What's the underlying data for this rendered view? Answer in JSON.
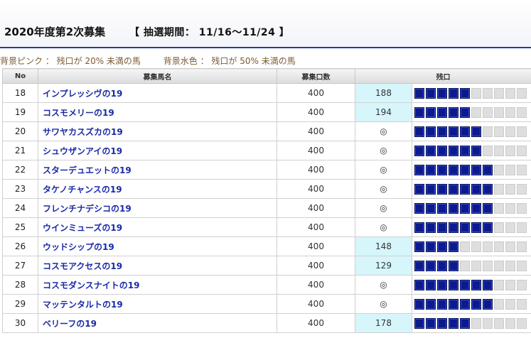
{
  "header": {
    "title": "2020年度第2次募集",
    "period": "【 抽選期間： 11/16～11/24 】"
  },
  "notes": {
    "pink": "背景ピンク ： 残口が 20% 未満の馬",
    "blue": "背景水色 ： 残口が 50% 未満の馬"
  },
  "table": {
    "columns": [
      "No",
      "募集馬名",
      "募集口数",
      "残口"
    ],
    "gauge_segments": 10,
    "colors": {
      "gauge_on": "#0b1a8f",
      "gauge_off": "#dedede",
      "low_remaining_bg": "#d6f6fb"
    },
    "rows": [
      {
        "no": "18",
        "name": "インプレッシヴの19",
        "quota": "400",
        "remaining": "188",
        "low": true,
        "gauge": 5
      },
      {
        "no": "19",
        "name": "コスモメリーの19",
        "quota": "400",
        "remaining": "194",
        "low": true,
        "gauge": 5
      },
      {
        "no": "20",
        "name": "サワヤカスズカの19",
        "quota": "400",
        "remaining": "◎",
        "low": false,
        "gauge": 6
      },
      {
        "no": "21",
        "name": "シュウザンアイの19",
        "quota": "400",
        "remaining": "◎",
        "low": false,
        "gauge": 6
      },
      {
        "no": "22",
        "name": "スターデュエットの19",
        "quota": "400",
        "remaining": "◎",
        "low": false,
        "gauge": 7
      },
      {
        "no": "23",
        "name": "タケノチャンスの19",
        "quota": "400",
        "remaining": "◎",
        "low": false,
        "gauge": 7
      },
      {
        "no": "24",
        "name": "フレンチナデシコの19",
        "quota": "400",
        "remaining": "◎",
        "low": false,
        "gauge": 7
      },
      {
        "no": "25",
        "name": "ウインミューズの19",
        "quota": "400",
        "remaining": "◎",
        "low": false,
        "gauge": 7
      },
      {
        "no": "26",
        "name": "ウッドシップの19",
        "quota": "400",
        "remaining": "148",
        "low": true,
        "gauge": 4
      },
      {
        "no": "27",
        "name": "コスモアクセスの19",
        "quota": "400",
        "remaining": "129",
        "low": true,
        "gauge": 4
      },
      {
        "no": "28",
        "name": "コスモダンスナイトの19",
        "quota": "400",
        "remaining": "◎",
        "low": false,
        "gauge": 7
      },
      {
        "no": "29",
        "name": "マッテンタルトの19",
        "quota": "400",
        "remaining": "◎",
        "low": false,
        "gauge": 7
      },
      {
        "no": "30",
        "name": "ベリーフの19",
        "quota": "400",
        "remaining": "178",
        "low": true,
        "gauge": 5
      }
    ]
  }
}
